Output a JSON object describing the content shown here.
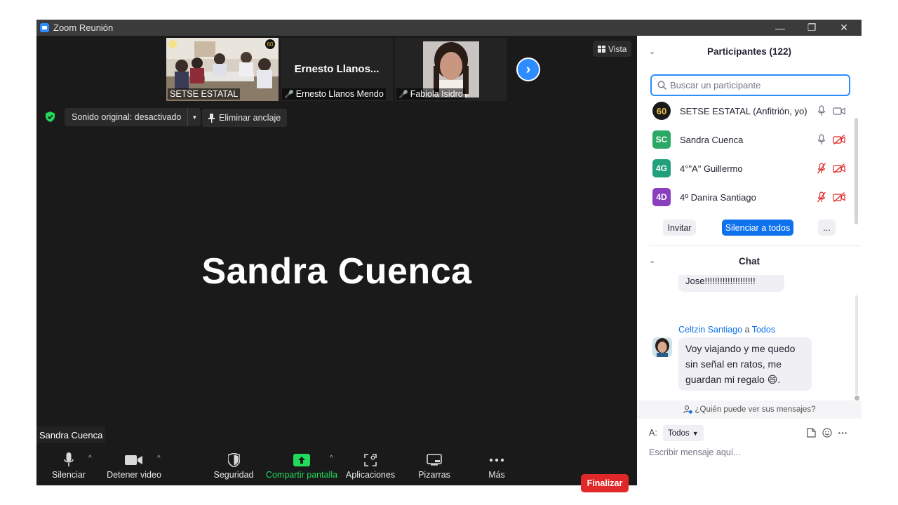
{
  "window": {
    "title": "Zoom Reunión",
    "minimize": "—",
    "restore": "❐",
    "close": "✕"
  },
  "thumbnails": [
    {
      "name": "SETSE ESTATAL"
    },
    {
      "big_name": "Ernesto  Llanos...",
      "name": "Ernesto Llanos Mendo",
      "muted": true
    },
    {
      "name": "Fabiola Isidro",
      "muted": true
    }
  ],
  "vista": {
    "label": "Vista"
  },
  "audio": {
    "sound_label": "Sonido original: desactivado",
    "unpin_label": "Eliminar anclaje"
  },
  "active_speaker": {
    "name": "Sandra Cuenca",
    "tag": "Sandra Cuenca"
  },
  "toolbar": {
    "mute": "Silenciar",
    "video": "Detener video",
    "security": "Seguridad",
    "share": "Compartir pantalla",
    "apps": "Aplicaciones",
    "whiteboard": "Pizarras",
    "more": "Más",
    "end": "Finalizar"
  },
  "participants": {
    "title": "Participantes (122)",
    "search_placeholder": "Buscar un participante",
    "list": [
      {
        "avatar": "60",
        "name": "SETSE ESTATAL (Anfitrión, yo)",
        "avatar_color": "#1a1a1a",
        "mic_muted": false,
        "cam_off": false
      },
      {
        "avatar": "SC",
        "name": "Sandra Cuenca",
        "avatar_color": "#2aa866",
        "mic_muted": false,
        "cam_off": true
      },
      {
        "avatar": "4G",
        "name": "4°\"A\" Guillermo",
        "avatar_color": "#20a07c",
        "mic_muted": true,
        "cam_off": true
      },
      {
        "avatar": "4D",
        "name": "4º Danira Santiago",
        "avatar_color": "#8a3fbf",
        "mic_muted": true,
        "cam_off": true
      }
    ],
    "invite": "Invitar",
    "mute_all": "Silenciar a todos",
    "more": "..."
  },
  "chat": {
    "title": "Chat",
    "prev_message": "Jose!!!!!!!!!!!!!!!!!!!!",
    "sender": "Celtzin Santiago",
    "to_word": "a",
    "recipient": "Todos",
    "message_lines": [
      "Voy viajando y me quedo",
      "sin señal en ratos,  me",
      "guardan mi regalo"
    ],
    "emoji": "😄",
    "emoji_tail": ".",
    "who_sees": "¿Quién puede ver sus mensajes?",
    "to_label": "A:",
    "to_value": "Todos",
    "input_placeholder": "Escribir mensaje aquí..."
  },
  "colors": {
    "accent": "#0e72ed",
    "end": "#e02828",
    "share": "#23d959"
  }
}
